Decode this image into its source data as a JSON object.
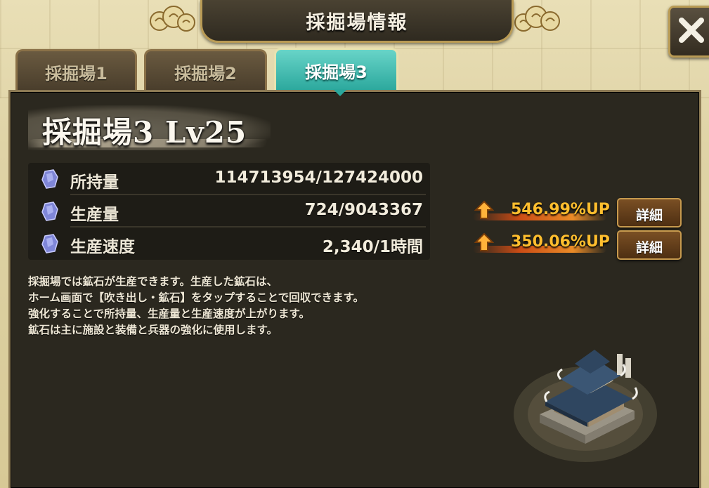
{
  "header": {
    "title": "採掘場情報"
  },
  "tabs": [
    {
      "label": "採掘場1"
    },
    {
      "label": "採掘場2"
    },
    {
      "label": "採掘場3"
    }
  ],
  "active_tab": "採掘場3",
  "panel": {
    "title": "採掘場3 Lv25"
  },
  "stats": [
    {
      "icon": "ore-crystal-icon",
      "label": "所持量",
      "value": "114713954/127424000"
    },
    {
      "icon": "ore-crystal-icon",
      "label": "生産量",
      "value": "724/9043367"
    },
    {
      "icon": "ore-crystal-icon",
      "label": "生産速度",
      "value": "2,340/1時間"
    }
  ],
  "boosts": [
    {
      "icon": "up-arrow-icon",
      "text": "546.99%UP",
      "button_label": "詳細"
    },
    {
      "icon": "up-arrow-icon",
      "text": "350.06%UP",
      "button_label": "詳細"
    }
  ],
  "description": [
    "採掘場では鉱石が生産できます。生産した鉱石は、",
    "ホーム画面で【吹き出し・鉱石】をタップすることで回収できます。",
    "強化することで所持量、生産量と生産速度が上がります。",
    "鉱石は主に施設と装備と兵器の強化に使用します。"
  ],
  "colors": {
    "active_tab": "#2aa79c",
    "boost_text": "#ffbe2e",
    "panel_bg": "#2b281f",
    "frame_gold": "#b99b55"
  }
}
